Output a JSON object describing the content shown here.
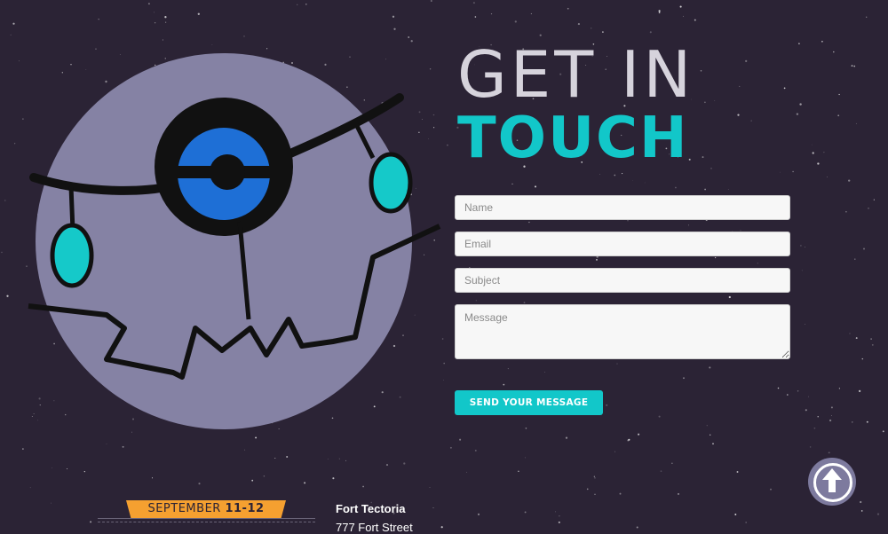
{
  "heading": {
    "line1": "GET IN",
    "line2": "TOUCH"
  },
  "form": {
    "name_placeholder": "Name",
    "email_placeholder": "Email",
    "subject_placeholder": "Subject",
    "message_placeholder": "Message",
    "submit_label": "SEND YOUR MESSAGE"
  },
  "event": {
    "date_prefix": "SEPTEMBER",
    "date_days": "11-12",
    "venue_name": "Fort Tectoria",
    "venue_address": "777 Fort Street"
  },
  "icons": {
    "mascot": "robot-face-icon",
    "scroll_top": "arrow-up-circle-icon"
  },
  "colors": {
    "background": "#2b2335",
    "accent": "#12c7c9",
    "orange": "#f5a030",
    "mascot_face": "#8582a4",
    "eye_blue": "#1e6fd6"
  }
}
